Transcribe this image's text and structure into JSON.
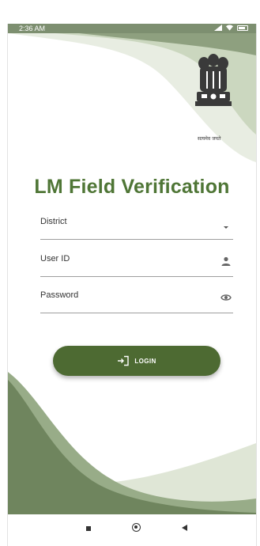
{
  "status_bar": {
    "time": "2:36 AM"
  },
  "header": {
    "emblem_caption": "सत्यमेव जयते",
    "title": "LM Field Verification"
  },
  "form": {
    "district_label": "District",
    "user_id_label": "User ID",
    "password_label": "Password"
  },
  "login_button": {
    "label": "LOGIN"
  },
  "theme": {
    "primary": "#4d6a32",
    "title_green": "#4f7636",
    "accent_light": "#dfe6d6"
  },
  "icons": {
    "district": "chevron-down-icon",
    "user_id": "person-icon",
    "password": "eye-icon",
    "login": "login-arrow-icon"
  },
  "nav_bar": {
    "recent": "square-icon",
    "home": "circle-icon",
    "back": "triangle-back-icon"
  }
}
